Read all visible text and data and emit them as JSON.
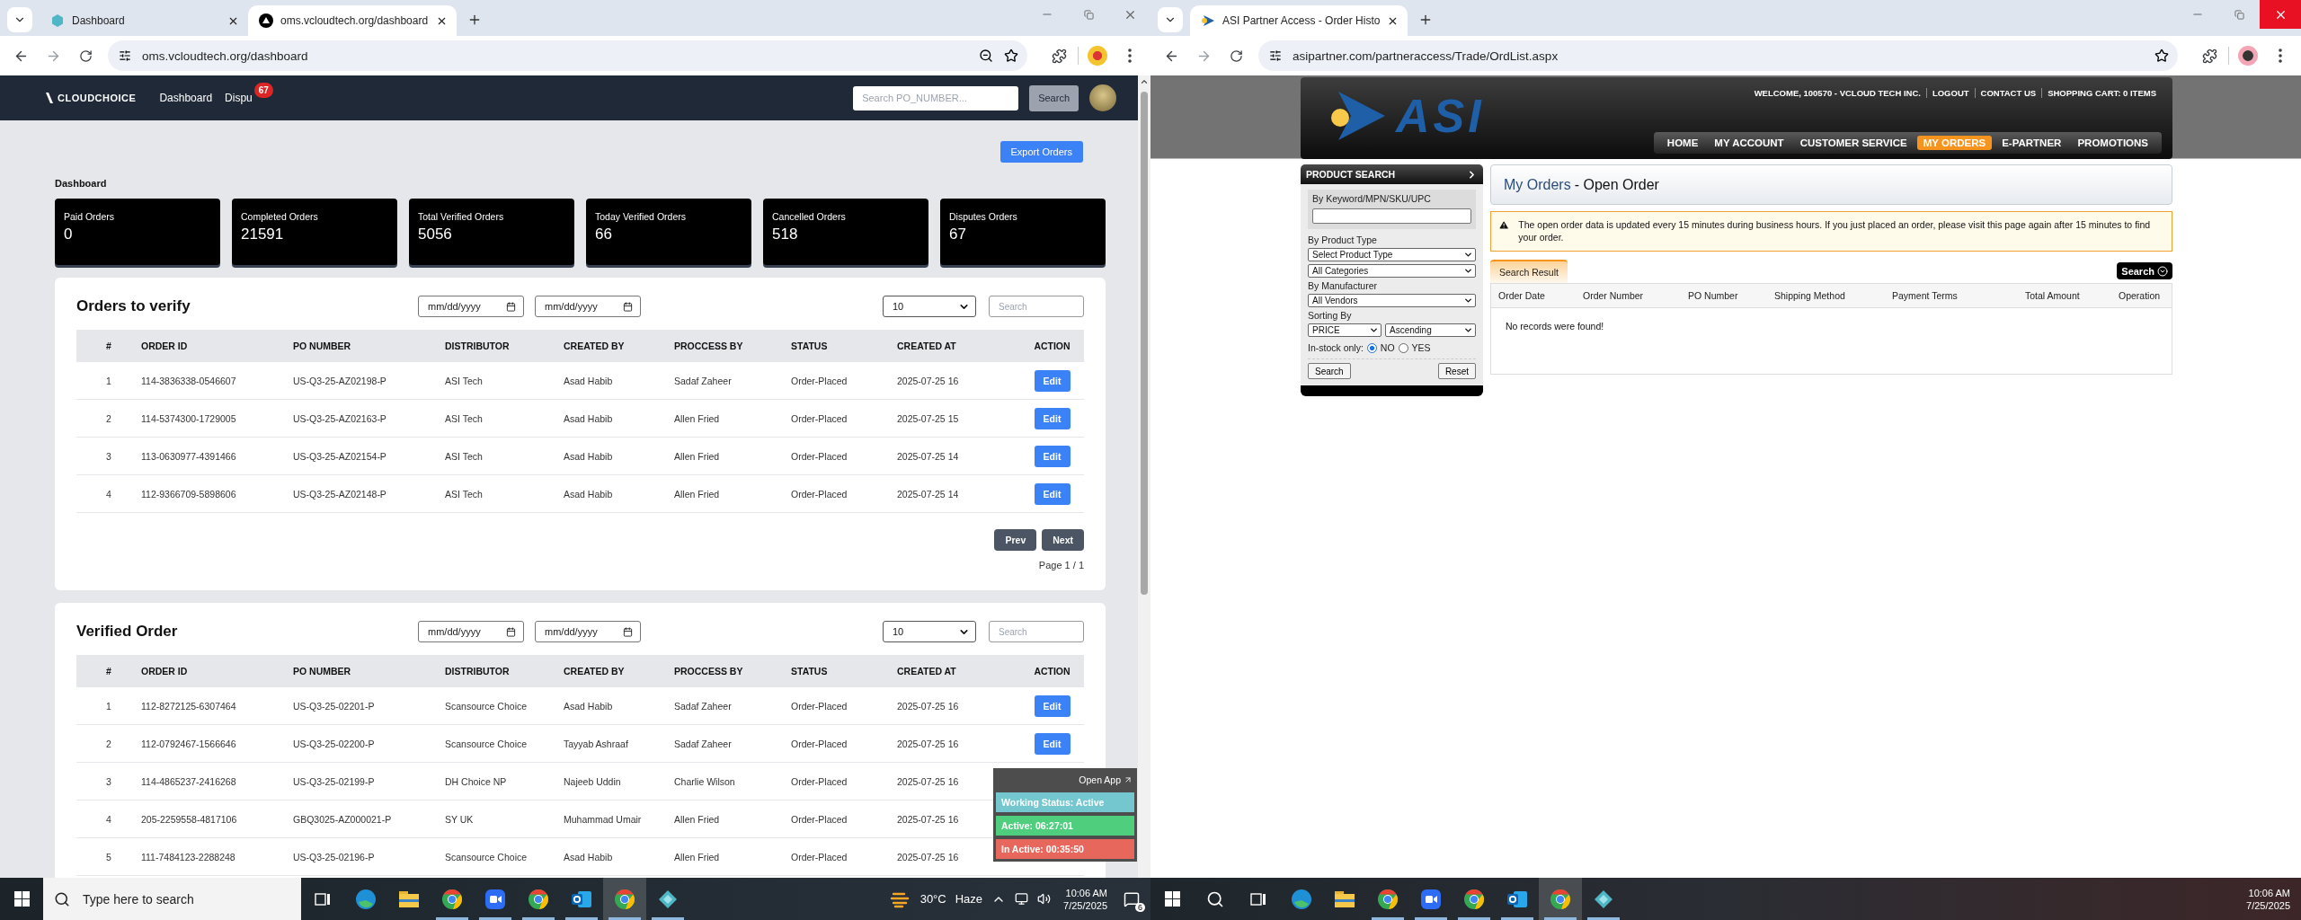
{
  "left_screen": {
    "tabs": [
      {
        "label": "Dashboard",
        "selected": false,
        "kind": "hexagon"
      },
      {
        "label": "oms.vcloudtech.org/dashboard",
        "selected": true,
        "kind": "triangle"
      }
    ],
    "url": "oms.vcloudtech.org/dashboard",
    "zoom_indicator": true,
    "window_close_highlighted": false,
    "nav": {
      "brand": "CLOUDCHOICE",
      "links": [
        {
          "label": "Dashboard"
        },
        {
          "label": "Dispu",
          "badge": "67"
        }
      ],
      "search_placeholder": "Search PO_NUMBER...",
      "search_button": "Search"
    },
    "export_button": "Export Orders",
    "section_title": "Dashboard",
    "stats": [
      {
        "label": "Paid Orders",
        "value": "0"
      },
      {
        "label": "Completed Orders",
        "value": "21591"
      },
      {
        "label": "Total Verified Orders",
        "value": "5056"
      },
      {
        "label": "Today Verified Orders",
        "value": "66"
      },
      {
        "label": "Cancelled Orders",
        "value": "518"
      },
      {
        "label": "Disputes Orders",
        "value": "67"
      }
    ],
    "tables": [
      {
        "title": "Orders to verify",
        "date_from": "mm/dd/yyyy",
        "date_to": "mm/dd/yyyy",
        "page_size": "10",
        "search_placeholder": "Search",
        "columns": [
          "#",
          "ORDER ID",
          "PO NUMBER",
          "DISTRIBUTOR",
          "CREATED BY",
          "PROCCESS BY",
          "STATUS",
          "CREATED AT",
          "ACTION"
        ],
        "rows": [
          {
            "cells": [
              "1",
              "114-3836338-0546607",
              "US-Q3-25-AZ02198-P",
              "ASI Tech",
              "Asad Habib",
              "Sadaf Zaheer",
              "Order-Placed",
              "2025-07-25 16"
            ],
            "action": "Edit"
          },
          {
            "cells": [
              "2",
              "114-5374300-1729005",
              "US-Q3-25-AZ02163-P",
              "ASI Tech",
              "Asad Habib",
              "Allen Fried",
              "Order-Placed",
              "2025-07-25 15"
            ],
            "action": "Edit"
          },
          {
            "cells": [
              "3",
              "113-0630977-4391466",
              "US-Q3-25-AZ02154-P",
              "ASI Tech",
              "Asad Habib",
              "Allen Fried",
              "Order-Placed",
              "2025-07-25 14"
            ],
            "action": "Edit"
          },
          {
            "cells": [
              "4",
              "112-9366709-5898606",
              "US-Q3-25-AZ02148-P",
              "ASI Tech",
              "Asad Habib",
              "Allen Fried",
              "Order-Placed",
              "2025-07-25 14"
            ],
            "action": "Edit"
          }
        ],
        "pagination": {
          "prev": "Prev",
          "next": "Next",
          "page": "Page 1 / 1"
        }
      },
      {
        "title": "Verified Order",
        "date_from": "mm/dd/yyyy",
        "date_to": "mm/dd/yyyy",
        "page_size": "10",
        "search_placeholder": "Search",
        "columns": [
          "#",
          "ORDER ID",
          "PO NUMBER",
          "DISTRIBUTOR",
          "CREATED BY",
          "PROCCESS BY",
          "STATUS",
          "CREATED AT",
          "ACTION"
        ],
        "rows": [
          {
            "cells": [
              "1",
              "112-8272125-6307464",
              "US-Q3-25-02201-P",
              "Scansource Choice",
              "Asad Habib",
              "Sadaf Zaheer",
              "Order-Placed",
              "2025-07-25 16"
            ],
            "action": "Edit"
          },
          {
            "cells": [
              "2",
              "112-0792467-1566646",
              "US-Q3-25-02200-P",
              "Scansource Choice",
              "Tayyab Ashraaf",
              "Sadaf Zaheer",
              "Order-Placed",
              "2025-07-25 16"
            ],
            "action": "Edit"
          },
          {
            "cells": [
              "3",
              "114-4865237-2416268",
              "US-Q3-25-02199-P",
              "DH Choice NP",
              "Najeeb Uddin",
              "Charlie Wilson",
              "Order-Placed",
              "2025-07-25 16"
            ]
          },
          {
            "cells": [
              "4",
              "205-2259558-4817106",
              "GBQ3025-AZ000021-P",
              "SY UK",
              "Muhammad Umair",
              "Allen Fried",
              "Order-Placed",
              "2025-07-25 16"
            ]
          },
          {
            "cells": [
              "5",
              "111-7484123-2288248",
              "US-Q3-25-02196-P",
              "Scansource Choice",
              "Asad Habib",
              "Allen Fried",
              "Order-Placed",
              "2025-07-25 16"
            ]
          }
        ]
      }
    ],
    "status_popup": {
      "open_app": "Open App",
      "statuses": [
        {
          "text": "Working Status: Active",
          "color": "#74c6cf"
        },
        {
          "text": "Active: 06:27:01",
          "color": "#4fcf7e"
        },
        {
          "text": "In Active: 00:35:50",
          "color": "#e8675d"
        }
      ]
    },
    "taskbar": {
      "search_placeholder": "Type here to search",
      "apps": [
        {
          "kind": "edge",
          "running": false,
          "selected": false
        },
        {
          "kind": "explorer",
          "running": false,
          "selected": false
        },
        {
          "kind": "chrome",
          "running": true,
          "selected": false
        },
        {
          "kind": "zoom",
          "running": true,
          "selected": false
        },
        {
          "kind": "chrome",
          "running": true,
          "selected": false
        },
        {
          "kind": "outlook",
          "running": true,
          "selected": false
        },
        {
          "kind": "chrome",
          "running": true,
          "selected": true
        },
        {
          "kind": "app",
          "running": true,
          "selected": false
        }
      ],
      "weather_temp": "30°C",
      "weather_text": "Haze",
      "time": "10:06 AM",
      "date": "7/25/2025",
      "notifications": "6"
    }
  },
  "right_screen": {
    "tabs": [
      {
        "label": "ASI Partner Access - Order Histo",
        "selected": true,
        "kind": "arrow"
      }
    ],
    "url": "asipartner.com/partneraccess/Trade/OrdList.aspx",
    "window_close_highlighted": true,
    "header": {
      "logo": "ASI",
      "top_links": [
        "WELCOME, 100570 - VCLOUD TECH INC.",
        "LOGOUT",
        "CONTACT US",
        "SHOPPING CART: 0 ITEMS"
      ],
      "nav": [
        {
          "label": "HOME",
          "selected": false
        },
        {
          "label": "MY ACCOUNT",
          "selected": false
        },
        {
          "label": "CUSTOMER SERVICE",
          "selected": false
        },
        {
          "label": "MY ORDERS",
          "selected": true
        },
        {
          "label": "E-PARTNER",
          "selected": false
        },
        {
          "label": "PROMOTIONS",
          "selected": false
        }
      ]
    },
    "sidebar": {
      "title": "PRODUCT SEARCH",
      "keyword_label": "By Keyword/MPN/SKU/UPC",
      "product_type_label": "By Product Type",
      "product_type": "Select Product Type",
      "category": "All Categories",
      "manufacturer_label": "By Manufacturer",
      "manufacturer": "All Vendors",
      "sorting_label": "Sorting By",
      "sort_field": "PRICE",
      "sort_order": "Ascending",
      "in_stock_label": "In-stock only:",
      "in_stock_options": [
        {
          "label": "NO",
          "selected": true
        },
        {
          "label": "YES",
          "selected": false
        }
      ],
      "search_button": "Search",
      "reset_button": "Reset"
    },
    "main": {
      "title_link": "My Orders",
      "title_rest": "- Open Order",
      "notice": "The open order data is updated every 15 minutes during business hours. If you just placed an order, please visit this page again after 15 minutes to find your order.",
      "result_tab": "Search Result",
      "search_button": "Search",
      "columns": [
        "Order Date",
        "Order Number",
        "PO Number",
        "Shipping Method",
        "Payment Terms",
        "Total Amount",
        "Operation"
      ],
      "empty_message": "No records were found!"
    },
    "taskbar": {
      "apps": [
        {
          "kind": "edge",
          "running": false,
          "selected": false
        },
        {
          "kind": "explorer",
          "running": false,
          "selected": false
        },
        {
          "kind": "chrome",
          "running": true,
          "selected": false
        },
        {
          "kind": "zoom",
          "running": true,
          "selected": false
        },
        {
          "kind": "chrome",
          "running": true,
          "selected": false
        },
        {
          "kind": "outlook",
          "running": true,
          "selected": false
        },
        {
          "kind": "chrome",
          "running": true,
          "selected": true
        },
        {
          "kind": "app",
          "running": true,
          "selected": false
        }
      ],
      "time": "10:06 AM",
      "date": "7/25/2025"
    }
  }
}
